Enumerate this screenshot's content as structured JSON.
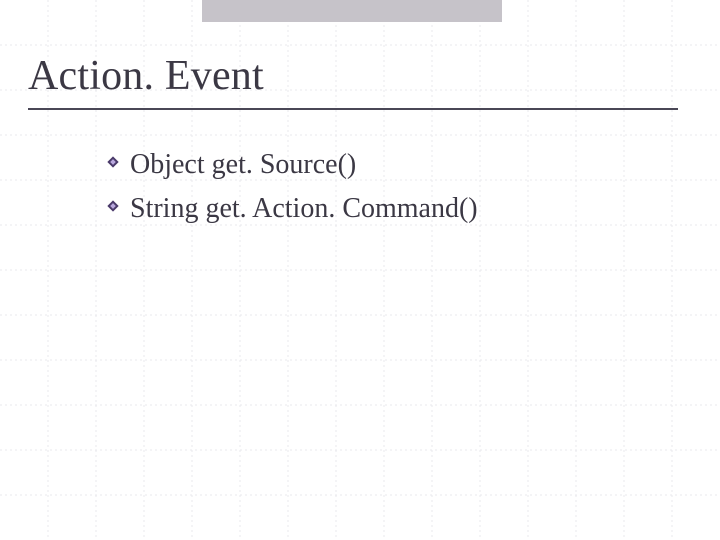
{
  "slide": {
    "title": "Action. Event",
    "items": [
      {
        "text": "Object get. Source()"
      },
      {
        "text": "String get. Action. Command()"
      }
    ]
  },
  "style": {
    "bullet_color_dark": "#4a3a6a",
    "bullet_color_light": "#b9a8dd"
  }
}
